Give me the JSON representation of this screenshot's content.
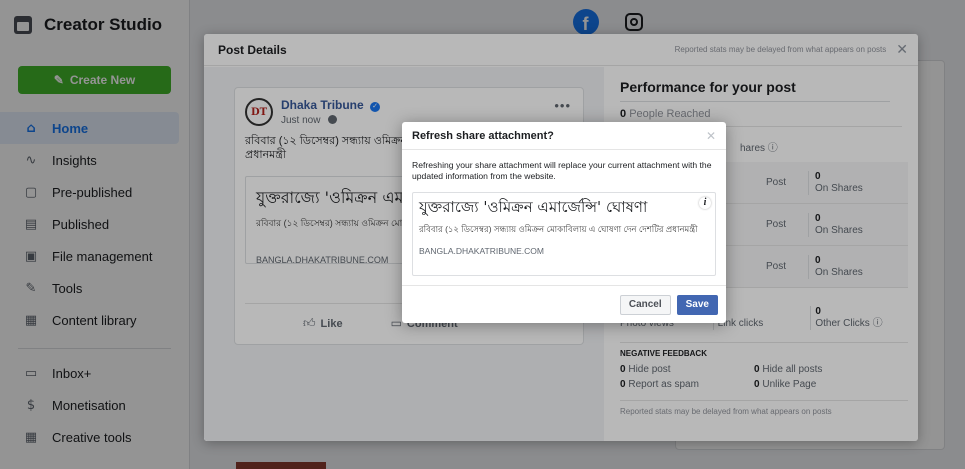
{
  "sidebar": {
    "brand": "Creator Studio",
    "create_label": "Create New",
    "items": [
      {
        "label": "Home",
        "icon": "home-icon",
        "glyph": "⌂"
      },
      {
        "label": "Insights",
        "icon": "insights-icon",
        "glyph": "∿"
      },
      {
        "label": "Pre-published",
        "icon": "document-icon",
        "glyph": "▢"
      },
      {
        "label": "Published",
        "icon": "calendar-icon",
        "glyph": "▤"
      },
      {
        "label": "File management",
        "icon": "file-icon",
        "glyph": "▣"
      },
      {
        "label": "Tools",
        "icon": "wrench-icon",
        "glyph": "✎"
      },
      {
        "label": "Content library",
        "icon": "library-icon",
        "glyph": "▦"
      },
      {
        "label": "Inbox+",
        "icon": "inbox-icon",
        "glyph": "▭"
      },
      {
        "label": "Monetisation",
        "icon": "dollar-icon",
        "glyph": "$"
      },
      {
        "label": "Creative tools",
        "icon": "creative-icon",
        "glyph": "▦"
      }
    ]
  },
  "post_details": {
    "title": "Post Details",
    "note": "Reported stats may be delayed from what appears on posts",
    "close": "✕"
  },
  "post": {
    "page_name": "Dhaka Tribune",
    "avatar_text": "DT",
    "time": "Just now",
    "text": "রবিবার (১২ ডিসেম্বর) সন্ধ্যায় ওমিক্রন মোকাবিলায় এ ঘোষণা দেন দেশটির প্রধানমন্ত্রী",
    "attachment_title": "যুক্তরাজ্যে 'ওমিক্রন এমার্জেন্সি' ঘোষণা",
    "attachment_desc": "রবিবার (১২ ডিসেম্বর) সন্ধ্যায় ওমিক্রন মোকাবিলায় এ ঘোষণা দেন দেশটির প্রধানমন্ত্রী",
    "attachment_domain": "BANGLA.DHAKATRIBUNE.COM",
    "like_label": "Like",
    "comment_label": "Comment"
  },
  "performance": {
    "title": "Performance for your post",
    "reached_value": "0",
    "reached_label": "People Reached",
    "shares_label": "hares",
    "rows": [
      {
        "left": "Post",
        "value": "0",
        "label": "On Shares"
      },
      {
        "left": "Post",
        "value": "0",
        "label": "On Shares"
      },
      {
        "left": "Post",
        "value": "0",
        "label": "On Shares"
      }
    ],
    "clicks": [
      {
        "value": "0",
        "label": "Photo views"
      },
      {
        "value": "0",
        "label": "Link clicks"
      },
      {
        "value": "0",
        "label": "Other Clicks"
      }
    ],
    "negative_title": "NEGATIVE FEEDBACK",
    "negative": [
      {
        "value": "0",
        "label": "Hide post"
      },
      {
        "value": "0",
        "label": "Hide all posts"
      },
      {
        "value": "0",
        "label": "Report as spam"
      },
      {
        "value": "0",
        "label": "Unlike Page"
      }
    ],
    "footer": "Reported stats may be delayed from what appears on posts"
  },
  "dialog": {
    "title": "Refresh share attachment?",
    "close": "✕",
    "body": "Refreshing your share attachment will replace your current attachment with the updated information from the website.",
    "preview_title": "যুক্তরাজ্যে 'ওমিক্রন এমার্জেন্সি' ঘোষণা",
    "preview_desc": "রবিবার (১২ ডিসেম্বর) সন্ধ্যায় ওমিক্রন মোকাবিলায় এ ঘোষণা দেন দেশটির প্রধানমন্ত্রী",
    "preview_domain": "BANGLA.DHAKATRIBUNE.COM",
    "info_glyph": "i",
    "cancel_label": "Cancel",
    "save_label": "Save"
  },
  "colors": {
    "accent": "#1877f2",
    "create_button": "#42b72a",
    "save_button": "#4267b2"
  }
}
